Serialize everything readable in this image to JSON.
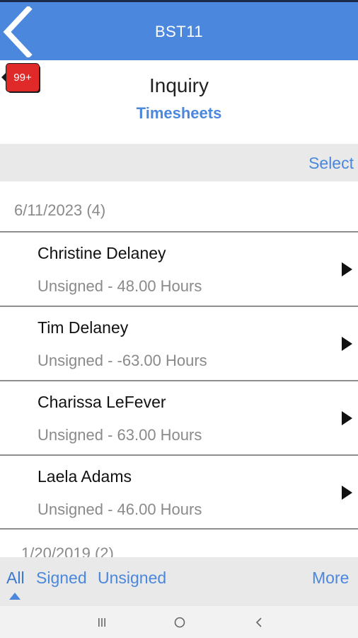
{
  "header": {
    "title": "BST11",
    "back_icon": "chevron-left-icon"
  },
  "badge": {
    "text": "99+",
    "color": "#e02a2a"
  },
  "page": {
    "title": "Inquiry",
    "subtitle": "Timesheets"
  },
  "toolbar": {
    "select_label": "Select"
  },
  "groups": [
    {
      "label": "6/11/2023 (4)",
      "items": [
        {
          "name": "Christine Delaney",
          "status": "Unsigned - 48.00 Hours"
        },
        {
          "name": "Tim Delaney",
          "status": "Unsigned - -63.00 Hours"
        },
        {
          "name": "Charissa LeFever",
          "status": "Unsigned - 63.00 Hours"
        },
        {
          "name": "Laela Adams",
          "status": "Unsigned - 46.00 Hours"
        }
      ]
    },
    {
      "label": "1/20/2019 (2)"
    }
  ],
  "filters": {
    "all": "All",
    "signed": "Signed",
    "unsigned": "Unsigned",
    "more": "More",
    "active": "All"
  },
  "colors": {
    "accent": "#4a87dd",
    "header_bg": "#4a87dd",
    "muted_text": "#8a8a8a"
  },
  "system_nav": {
    "icons": [
      "recent-apps-icon",
      "home-icon",
      "back-icon"
    ]
  }
}
